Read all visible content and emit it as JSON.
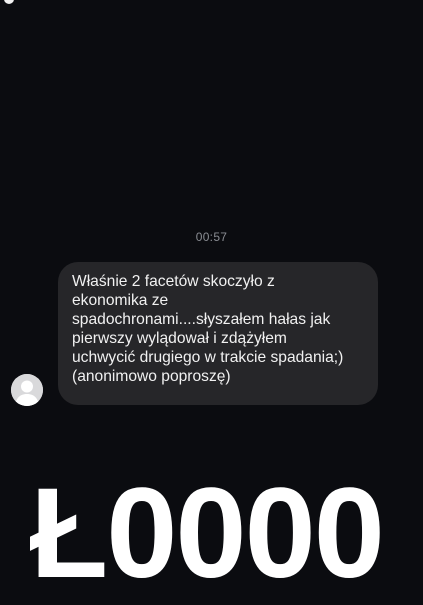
{
  "chat": {
    "timestamp": "00:57",
    "message": {
      "lines": [
        "Właśnie 2 facetów skoczyło z",
        "ekonomika ze",
        "spadochronami....słyszałem hałas jak",
        "pierwszy wylądował i zdążyłem",
        "uchwycić drugiego w trakcie spadania;)",
        "(anonimowo poproszę)"
      ]
    }
  },
  "overlay": {
    "text": "Ł0000"
  },
  "colors": {
    "background": "#0b0c10",
    "bubble": "#262629",
    "timestamp": "#8a8d93",
    "text": "#f1f1f1"
  },
  "icons": {
    "avatar": "default-profile-icon"
  }
}
